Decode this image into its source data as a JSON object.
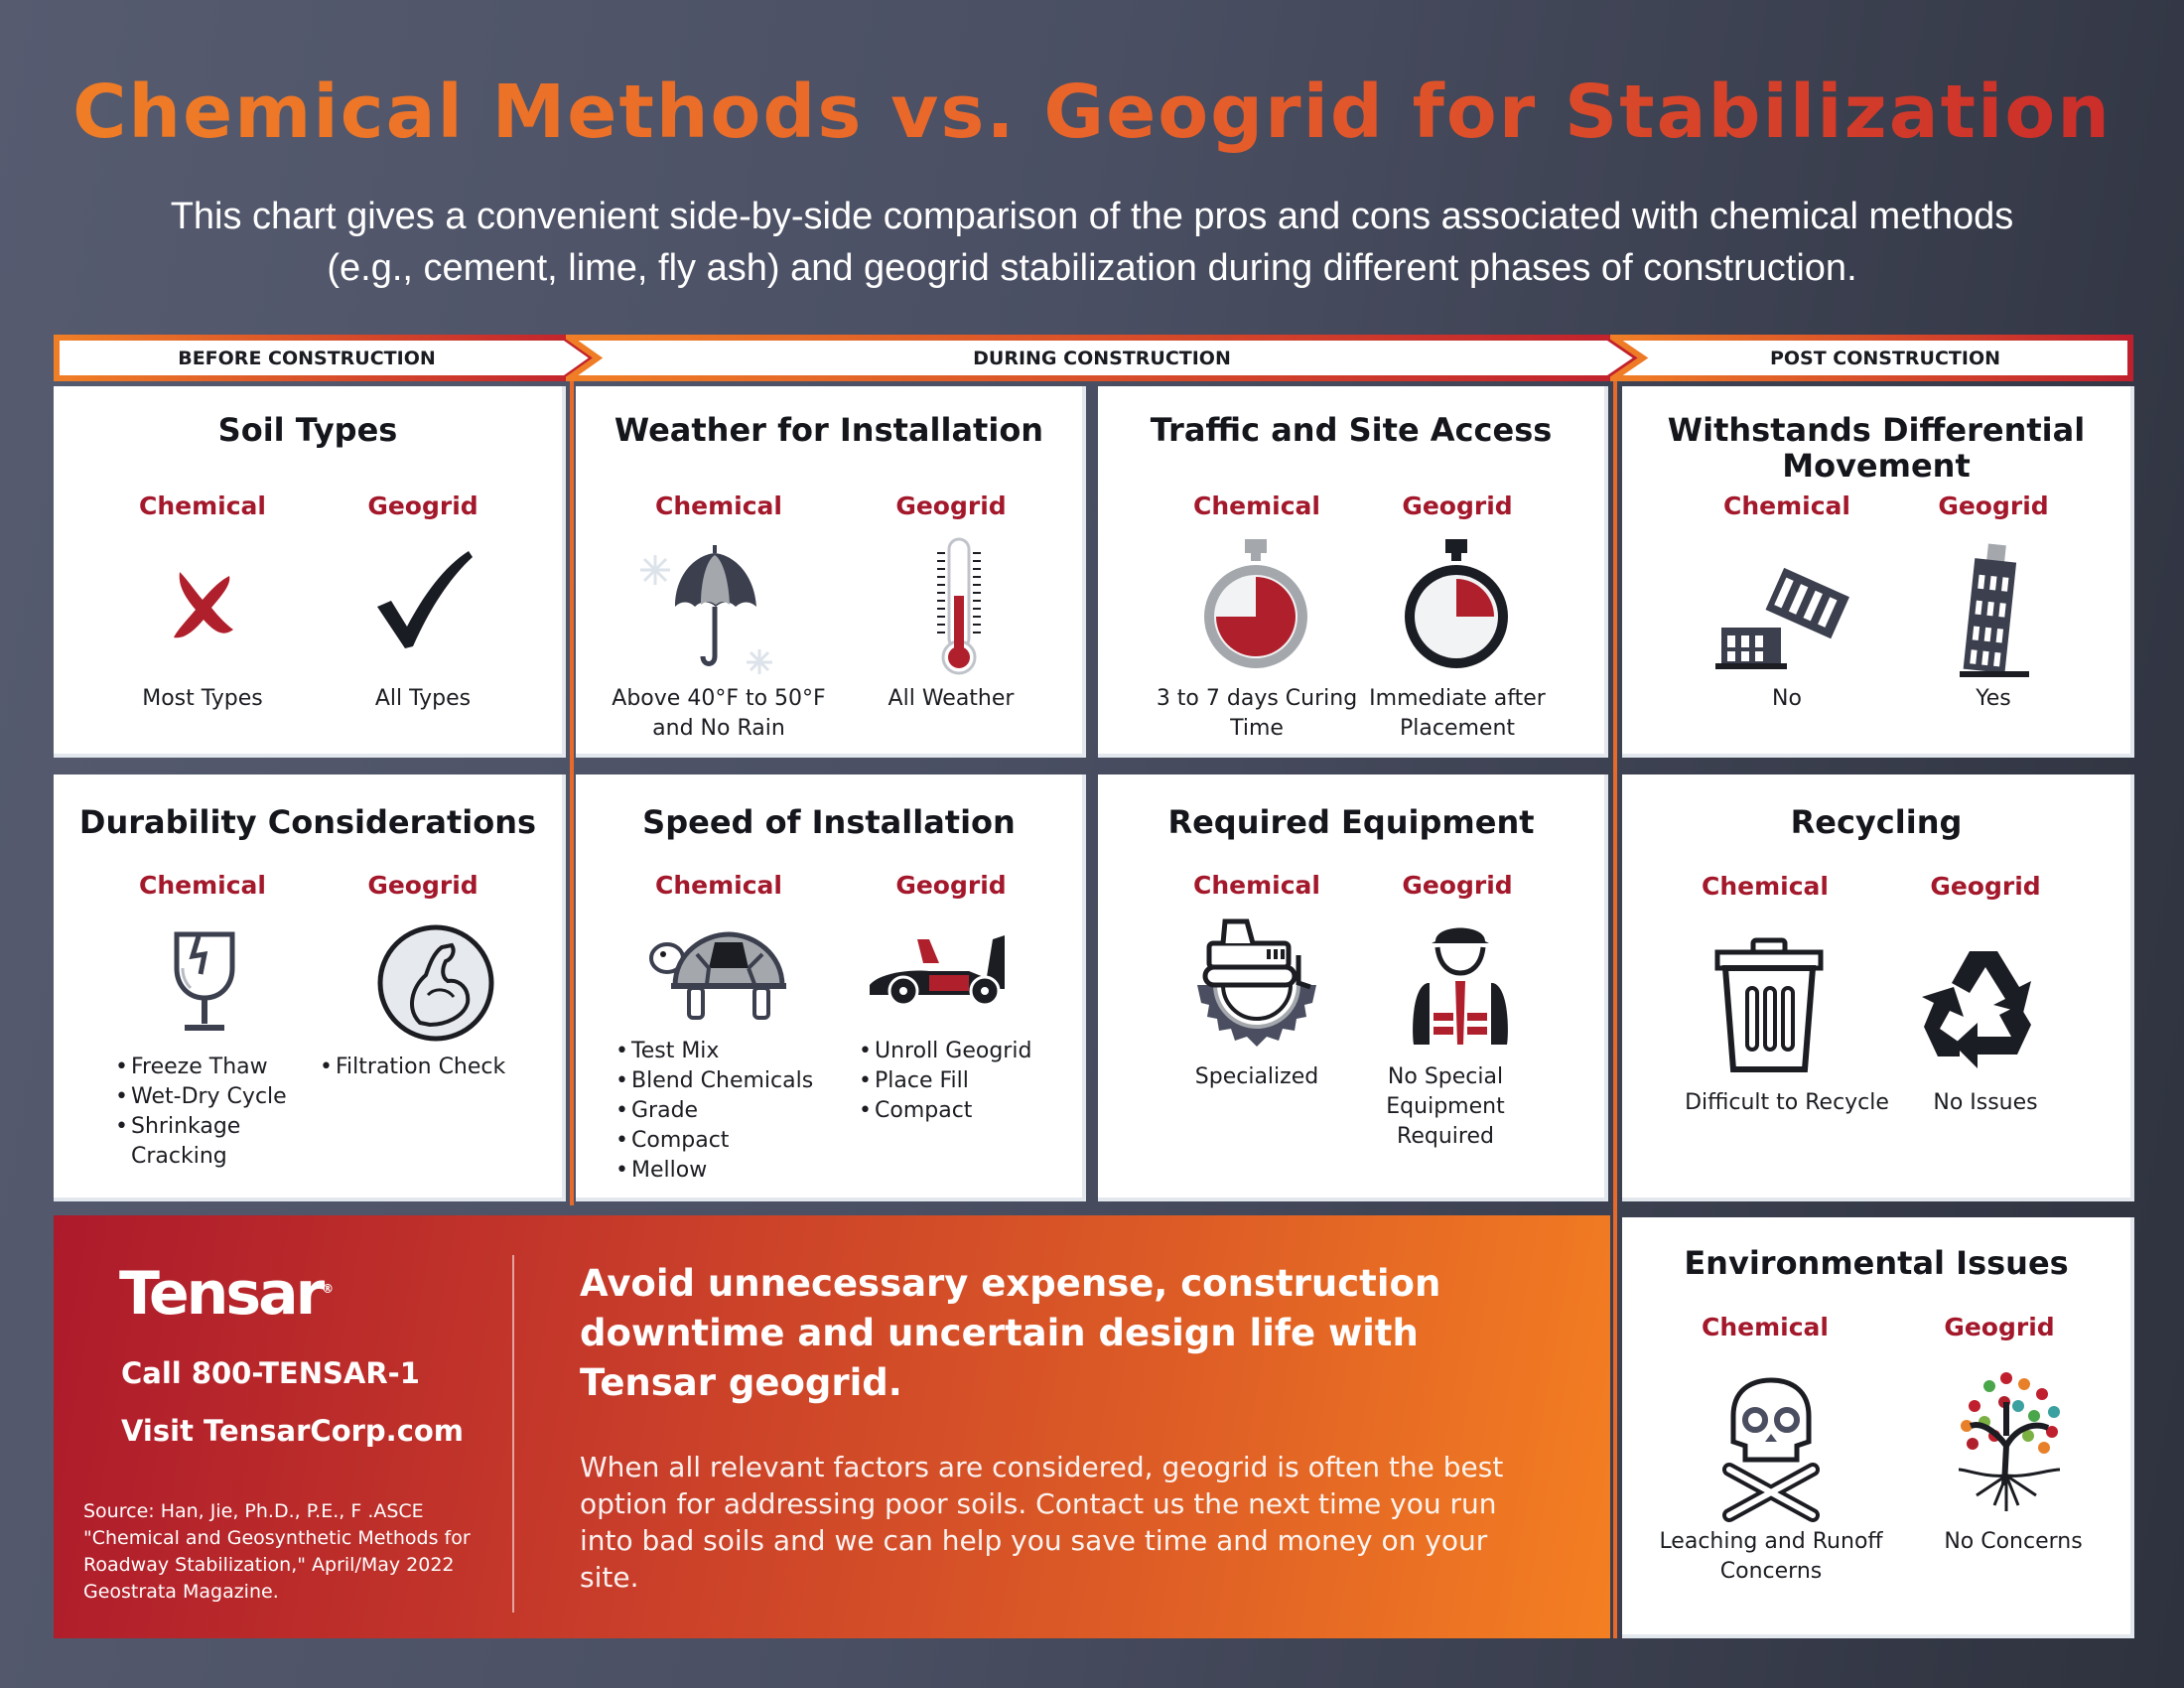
{
  "header": {
    "title": "Chemical Methods vs. Geogrid for Stabilization",
    "subtitle": "This chart gives a convenient side-by-side comparison of the pros and cons associated with chemical methods (e.g., cement, lime, fly ash) and geogrid stabilization during different phases of construction."
  },
  "colors": {
    "accent_red": "#a3182b",
    "accent_orange": "#f07e26",
    "band_red": "#c0202d",
    "dark": "#1b1d22",
    "gray_icon": "#a4a8ad"
  },
  "phases": [
    {
      "label": "BEFORE CONSTRUCTION"
    },
    {
      "label": "DURING CONSTRUCTION"
    },
    {
      "label": "POST CONSTRUCTION"
    }
  ],
  "column_labels": {
    "chemical": "Chemical",
    "geogrid": "Geogrid"
  },
  "cards": {
    "soil_types": {
      "title": "Soil Types",
      "chemical": {
        "icon": "x-mark-icon",
        "text": "Most Types"
      },
      "geogrid": {
        "icon": "checkmark-icon",
        "text": "All Types"
      }
    },
    "weather": {
      "title": "Weather for Installation",
      "chemical": {
        "icon": "umbrella-snow-icon",
        "text": "Above 40°F to 50°F and No Rain"
      },
      "geogrid": {
        "icon": "thermometer-icon",
        "text": "All Weather"
      }
    },
    "traffic": {
      "title": "Traffic and Site Access",
      "chemical": {
        "icon": "stopwatch-icon",
        "text": "3 to 7 days Curing Time"
      },
      "geogrid": {
        "icon": "stopwatch-icon",
        "text": "Immediate after Placement"
      }
    },
    "differential": {
      "title": "Withstands Differential Movement",
      "chemical": {
        "icon": "broken-tower-icon",
        "text": "No"
      },
      "geogrid": {
        "icon": "leaning-tower-icon",
        "text": "Yes"
      }
    },
    "durability": {
      "title": "Durability Considerations",
      "chemical": {
        "icon": "fragile-glass-icon",
        "bullets": [
          "Freeze Thaw",
          "Wet-Dry Cycle",
          "Shrinkage Cracking"
        ]
      },
      "geogrid": {
        "icon": "strong-arm-icon",
        "bullets": [
          "Filtration Check"
        ]
      }
    },
    "speed": {
      "title": "Speed of Installation",
      "chemical": {
        "icon": "turtle-icon",
        "bullets": [
          "Test Mix",
          "Blend Chemicals",
          "Grade",
          "Compact",
          "Mellow"
        ]
      },
      "geogrid": {
        "icon": "race-car-icon",
        "bullets": [
          "Unroll Geogrid",
          "Place Fill",
          "Compact"
        ]
      }
    },
    "equipment": {
      "title": "Required Equipment",
      "chemical": {
        "icon": "bulldozer-gear-icon",
        "text": "Specialized"
      },
      "geogrid": {
        "icon": "worker-icon",
        "text": "No Special Equipment Required"
      }
    },
    "recycling": {
      "title": "Recycling",
      "chemical": {
        "icon": "trash-can-icon",
        "text": "Difficult to Recycle"
      },
      "geogrid": {
        "icon": "recycle-icon",
        "text": "No Issues"
      }
    },
    "environmental": {
      "title": "Environmental Issues",
      "chemical": {
        "icon": "skull-crossbones-icon",
        "text": "Leaching and Runoff Concerns"
      },
      "geogrid": {
        "icon": "tree-icon",
        "text": "No Concerns"
      }
    }
  },
  "banner": {
    "logo": "Tensar",
    "logo_mark": "®",
    "phone": "Call 800-TENSAR-1",
    "website": "Visit TensarCorp.com",
    "source": "Source: Han, Jie, Ph.D., P.E., F .ASCE \"Chemical and Geosynthetic Methods for Roadway Stabilization,\" April/May 2022 Geostrata Magazine.",
    "headline": "Avoid unnecessary expense, construction downtime and uncertain design life with Tensar geogrid.",
    "body": "When all relevant factors are considered, geogrid is often the best option for addressing poor soils. Contact us the next time you run into bad soils and we can help you save time and money on your site."
  }
}
